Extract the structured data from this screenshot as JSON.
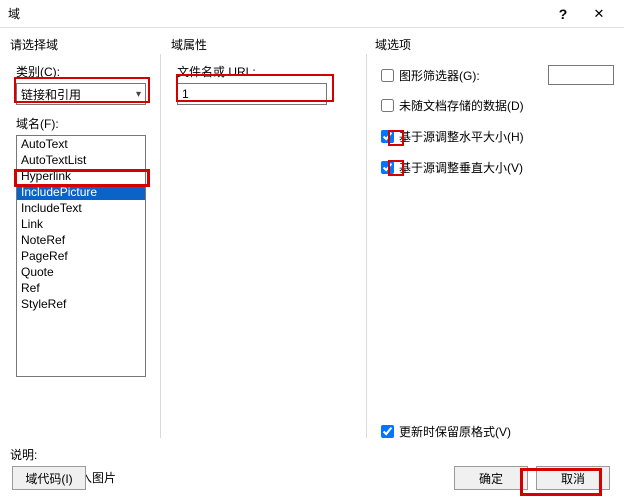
{
  "title": "域",
  "titlebar": {
    "help": "?",
    "close": "✕"
  },
  "left": {
    "section": "请选择域",
    "category_label": "类别(C):",
    "category_value": "链接和引用",
    "fieldnames_label": "域名(F):",
    "items": [
      "AutoText",
      "AutoTextList",
      "Hyperlink",
      "IncludePicture",
      "IncludeText",
      "Link",
      "NoteRef",
      "PageRef",
      "Quote",
      "Ref",
      "StyleRef"
    ],
    "selected_index": 3
  },
  "mid": {
    "section": "域属性",
    "filename_label": "文件名或 URL:",
    "filename_value": "1"
  },
  "right": {
    "section": "域选项",
    "opts": [
      {
        "label": "图形筛选器(G):",
        "checked": false,
        "has_input": true
      },
      {
        "label": "未随文档存储的数据(D)",
        "checked": false
      },
      {
        "label": "基于源调整水平大小(H)",
        "checked": true
      },
      {
        "label": "基于源调整垂直大小(V)",
        "checked": true
      }
    ],
    "preserve": {
      "label": "更新时保留原格式(V)",
      "checked": true
    }
  },
  "desc": {
    "label": "说明:",
    "text": "通过文件插入图片"
  },
  "buttons": {
    "code": "域代码(I)",
    "ok": "确定",
    "cancel": "取消"
  },
  "watermark": ""
}
